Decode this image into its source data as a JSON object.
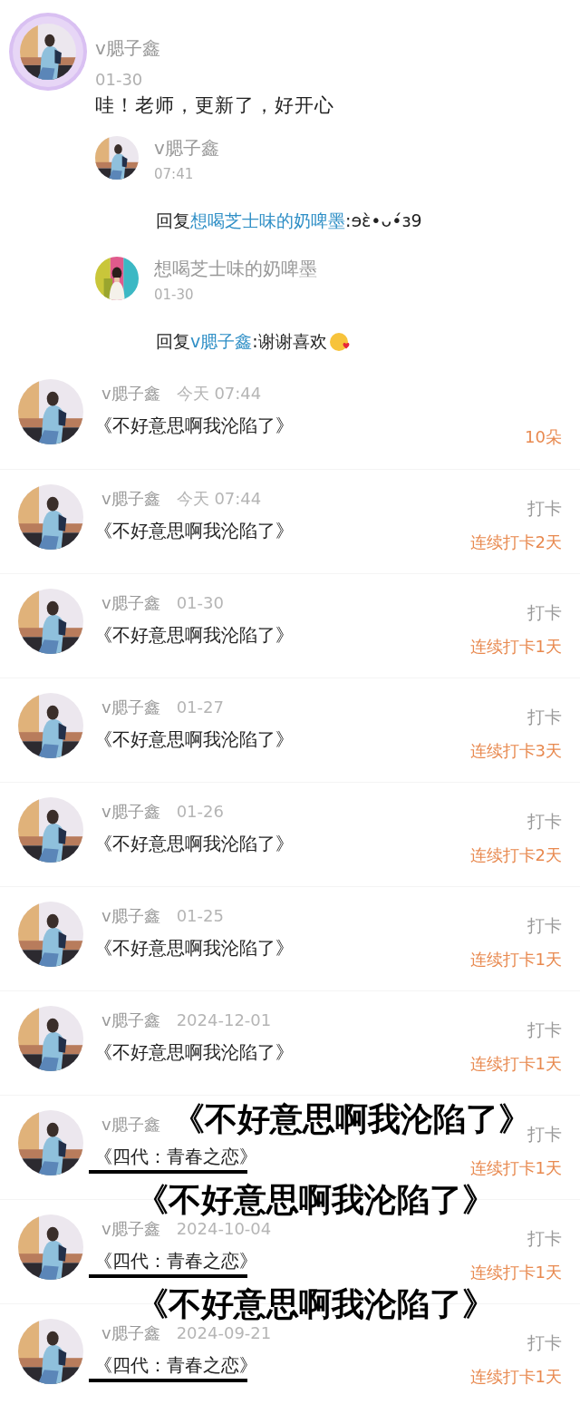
{
  "comment": {
    "author": "v腮子鑫",
    "date": "01-30",
    "text": "哇！老师，更新了，好开心",
    "replies": [
      {
        "author": "v腮子鑫",
        "time": "07:41",
        "prefix": "回复",
        "mention": "想喝芝士味的奶啤墨",
        "text": ":ɘɛ̀•ᴗ•́ɜ9",
        "emoji": false
      },
      {
        "author": "想喝芝士味的奶啤墨",
        "time": "01-30",
        "prefix": "回复",
        "mention": "v腮子鑫",
        "text": ":谢谢喜欢",
        "emoji": true
      }
    ]
  },
  "entries": [
    {
      "author": "v腮子鑫",
      "time": "今天 07:44",
      "title": "《不好意思啊我沦陷了》",
      "struck": false,
      "reward": "10朵"
    },
    {
      "author": "v腮子鑫",
      "time": "今天 07:44",
      "title": "《不好意思啊我沦陷了》",
      "struck": false,
      "tag": "打卡",
      "reward": "连续打卡2天"
    },
    {
      "author": "v腮子鑫",
      "time": "01-30",
      "title": "《不好意思啊我沦陷了》",
      "struck": false,
      "tag": "打卡",
      "reward": "连续打卡1天"
    },
    {
      "author": "v腮子鑫",
      "time": "01-27",
      "title": "《不好意思啊我沦陷了》",
      "struck": false,
      "tag": "打卡",
      "reward": "连续打卡3天"
    },
    {
      "author": "v腮子鑫",
      "time": "01-26",
      "title": "《不好意思啊我沦陷了》",
      "struck": false,
      "tag": "打卡",
      "reward": "连续打卡2天"
    },
    {
      "author": "v腮子鑫",
      "time": "01-25",
      "title": "《不好意思啊我沦陷了》",
      "struck": false,
      "tag": "打卡",
      "reward": "连续打卡1天"
    },
    {
      "author": "v腮子鑫",
      "time": "2024-12-01",
      "title": "《不好意思啊我沦陷了》",
      "struck": false,
      "tag": "打卡",
      "reward": "连续打卡1天"
    },
    {
      "author": "v腮子鑫",
      "title": "《四代：青春之恋》",
      "struck": true,
      "tag": "打卡",
      "reward": "连续打卡1天",
      "caption": "《不好意思啊我沦陷了》"
    },
    {
      "author": "v腮子鑫",
      "time": "2024-10-04",
      "title": "《四代：青春之恋》",
      "struck": true,
      "tag": "打卡",
      "reward": "连续打卡1天",
      "caption": "《不好意思啊我沦陷了》"
    },
    {
      "author": "v腮子鑫",
      "time": "2024-09-21",
      "title": "《四代：青春之恋》",
      "struck": true,
      "tag": "打卡",
      "reward": "连续打卡1天",
      "caption": "《不好意思啊我沦陷了》"
    }
  ]
}
